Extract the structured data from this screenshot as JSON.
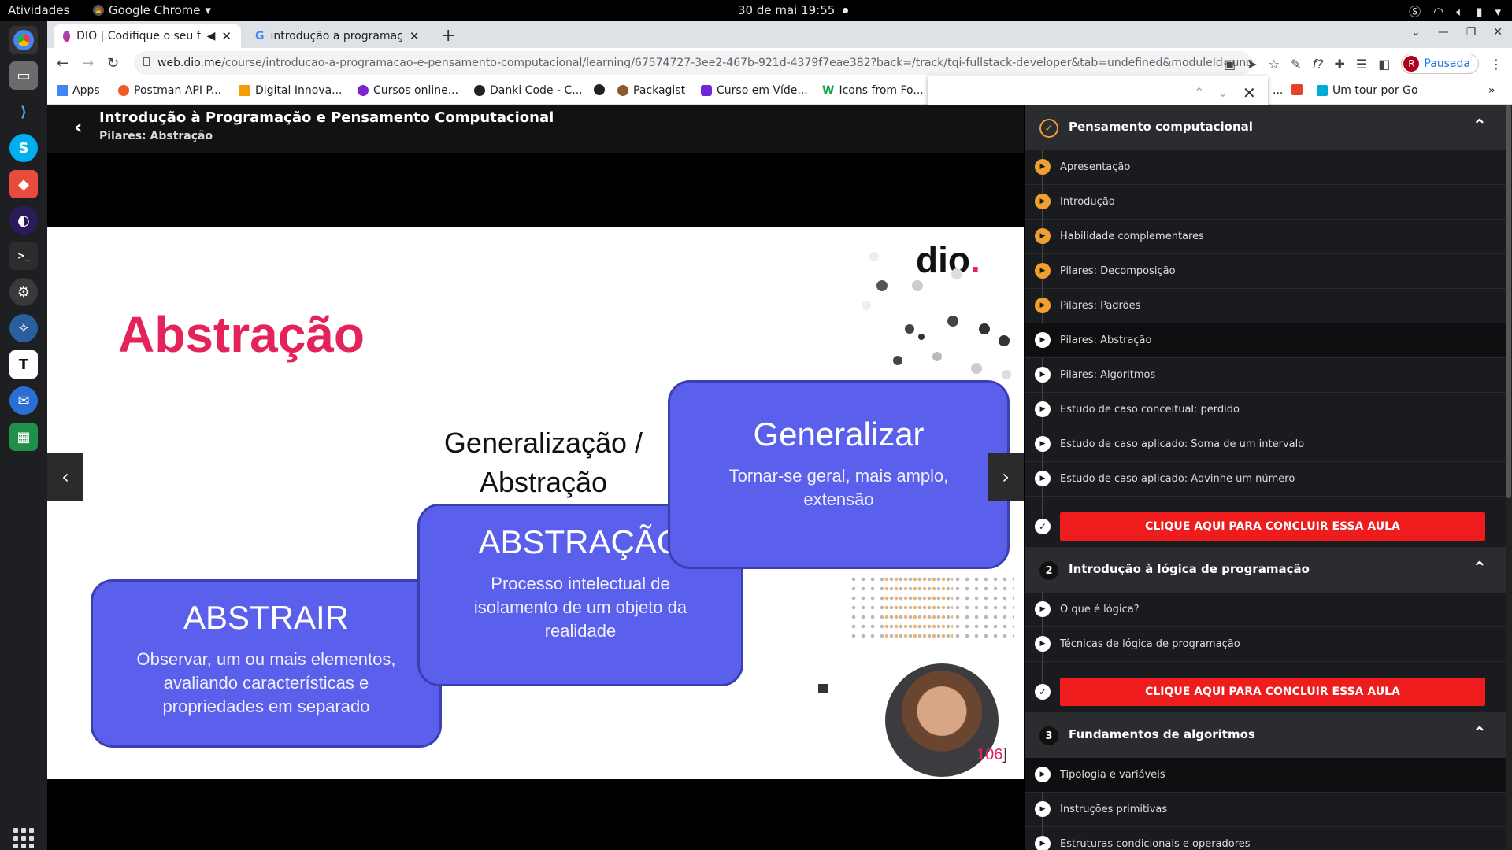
{
  "system": {
    "activities": "Atividades",
    "app_name": "Google Chrome",
    "clock": "30 de mai  19:55"
  },
  "browser": {
    "tabs": [
      {
        "title": "DIO | Codifique o seu f"
      },
      {
        "title": "introdução a programaç"
      }
    ],
    "url_domain": "web.dio.me",
    "url_path": "/course/introducao-a-programacao-e-pensamento-computacional/learning/67574727-3ee2-467b-921d-4379f7eae382?back=/track/tqi-fullstack-developer&tab=undefined&moduleId=undefined",
    "profile_initial": "R",
    "profile_label": "Pausada",
    "bookmarks": [
      {
        "label": "Apps",
        "color": "#4285f4"
      },
      {
        "label": "Postman API P...",
        "color": "#ef5b25"
      },
      {
        "label": "Digital Innova...",
        "color": "#f59e0b"
      },
      {
        "label": "Cursos online...",
        "color": "#7e22ce"
      },
      {
        "label": "Danki Code - C...",
        "color": "#222222"
      },
      {
        "label": "",
        "color": "#222222"
      },
      {
        "label": "Packagist",
        "color": "#8b5a2b"
      },
      {
        "label": "Curso em Víde...",
        "color": "#6d28d9"
      },
      {
        "label": "Icons from Fo...",
        "color": "#16a34a"
      },
      {
        "label": "...",
        "color": "#ffffff"
      },
      {
        "label": "",
        "color": "#e24329"
      },
      {
        "label": "Um tour por Go",
        "color": "#00acd7"
      }
    ]
  },
  "course": {
    "title": "Introdução à Programação e Pensamento Computacional",
    "subtitle": "Pilares: Abstração"
  },
  "slide": {
    "title": "Abstração",
    "gen_label_1": "Generalização /",
    "gen_label_2": "Abstração",
    "cards": [
      {
        "heading": "ABSTRAIR",
        "text": "Observar, um ou mais elementos, avaliando características e propriedades em separado"
      },
      {
        "heading": "ABSTRAÇÃO",
        "text": "Processo intelectual de isolamento de um objeto da realidade"
      },
      {
        "heading": "Generalizar",
        "text": "Tornar-se geral, mais amplo, extensão"
      }
    ],
    "logo": "dio",
    "page_number": "106",
    "bracket_close": "]"
  },
  "sidebar": {
    "modules": [
      {
        "number": "✓",
        "title": "Pensamento computacional",
        "lessons": [
          {
            "label": "Apresentação",
            "watched": true
          },
          {
            "label": "Introdução",
            "watched": true
          },
          {
            "label": "Habilidade complementares",
            "watched": true
          },
          {
            "label": "Pilares: Decomposição",
            "watched": true
          },
          {
            "label": "Pilares: Padrões",
            "watched": true
          },
          {
            "label": "Pilares: Abstração",
            "current": true
          },
          {
            "label": "Pilares: Algoritmos"
          },
          {
            "label": "Estudo de caso conceitual: perdido"
          },
          {
            "label": "Estudo de caso aplicado: Soma de um intervalo"
          },
          {
            "label": "Estudo de caso aplicado: Advinhe um número"
          }
        ],
        "conclude": "CLIQUE AQUI PARA CONCLUIR ESSA AULA"
      },
      {
        "number": "2",
        "title": "Introdução à lógica de programação",
        "lessons": [
          {
            "label": "O que é lógica?"
          },
          {
            "label": "Técnicas de lógica de programação"
          }
        ],
        "conclude": "CLIQUE AQUI PARA CONCLUIR ESSA AULA"
      },
      {
        "number": "3",
        "title": "Fundamentos de algoritmos",
        "lessons": [
          {
            "label": "Tipologia e variáveis"
          },
          {
            "label": "Instruções primitivas"
          },
          {
            "label": "Estruturas condicionais e operadores"
          }
        ]
      }
    ]
  }
}
